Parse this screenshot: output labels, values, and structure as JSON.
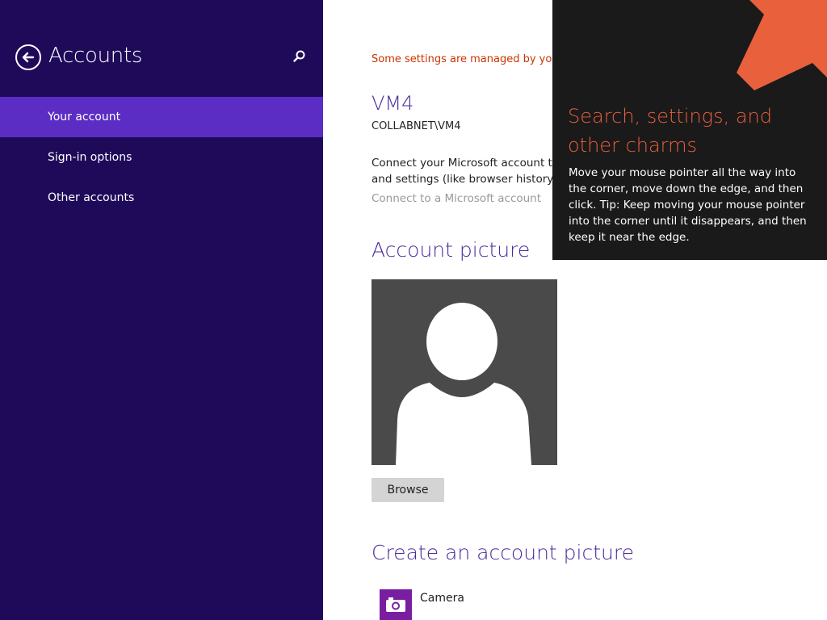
{
  "sidebar": {
    "title": "Accounts",
    "items": [
      {
        "label": "Your account",
        "selected": true
      },
      {
        "label": "Sign-in options",
        "selected": false
      },
      {
        "label": "Other accounts",
        "selected": false
      }
    ]
  },
  "main": {
    "managed_message": "Some settings are managed by yo",
    "account_name": "VM4",
    "account_domain": "COLLABNET\\VM4",
    "connect_description_line1": "Connect your Microsoft account to",
    "connect_description_line2": "and settings (like browser history ar",
    "connect_link": "Connect to a Microsoft account",
    "account_picture_heading": "Account picture",
    "browse_label": "Browse",
    "create_picture_heading": "Create an account picture",
    "camera_label": "Camera"
  },
  "tip": {
    "title_line1": "Search, settings, and",
    "title_line2": "other charms",
    "body": "Move your mouse pointer all the way into the corner, move down the edge, and then click. Tip: Keep moving your mouse pointer into the corner until it disappears, and then keep it near the edge."
  },
  "icons": {
    "back": "back-arrow-icon",
    "search": "search-icon",
    "avatar": "user-silhouette-icon",
    "camera": "camera-icon",
    "tip_arrow": "diagonal-arrow-icon"
  },
  "colors": {
    "sidebar_bg": "#1f0a5a",
    "selected_item_bg": "#5b2dc4",
    "heading_purple": "#4b2a9a",
    "managed_warning": "#cc3300",
    "tip_bg": "#1a1a1a",
    "tip_accent": "#e8603c",
    "camera_tile": "#7a1ea1"
  }
}
